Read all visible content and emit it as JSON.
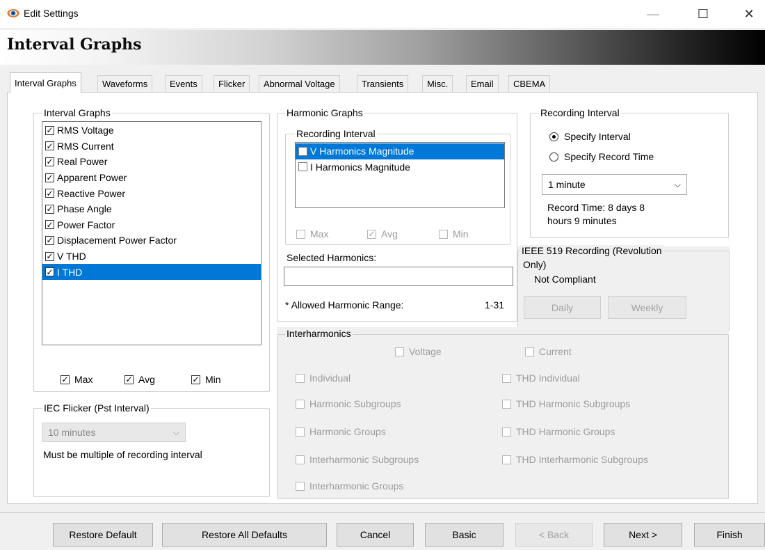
{
  "window": {
    "title": "Edit Settings",
    "minimize_glyph": "—",
    "maximize_glyph": "☐",
    "close_glyph": "✕"
  },
  "banner": {
    "title": "Interval Graphs"
  },
  "tabs": [
    {
      "label": "Interval Graphs",
      "active": true
    },
    {
      "label": "Waveforms"
    },
    {
      "label": "Events"
    },
    {
      "label": "Flicker"
    },
    {
      "label": "Abnormal Voltage"
    },
    {
      "label": "Transients"
    },
    {
      "label": "Misc."
    },
    {
      "label": "Email"
    },
    {
      "label": "CBEMA"
    }
  ],
  "interval_graphs": {
    "legend": "Interval Graphs",
    "items": [
      {
        "label": "RMS Voltage",
        "checked": true
      },
      {
        "label": "RMS Current",
        "checked": true
      },
      {
        "label": "Real Power",
        "checked": true
      },
      {
        "label": "Apparent Power",
        "checked": true
      },
      {
        "label": "Reactive Power",
        "checked": true
      },
      {
        "label": "Phase Angle",
        "checked": true
      },
      {
        "label": "Power Factor",
        "checked": true
      },
      {
        "label": "Displacement Power Factor",
        "checked": true
      },
      {
        "label": "V THD",
        "checked": true
      },
      {
        "label": "I THD",
        "checked": true,
        "selected": true
      }
    ],
    "max_label": "Max",
    "avg_label": "Avg",
    "min_label": "Min"
  },
  "iec_flicker": {
    "legend": "IEC Flicker (Pst Interval)",
    "selected": "10 minutes",
    "note": "Must be multiple of recording interval"
  },
  "harmonic_graphs": {
    "legend": "Harmonic Graphs",
    "recording_interval_legend": "Recording Interval",
    "items": [
      {
        "label": "V Harmonics Magnitude",
        "checked": false,
        "selected": true
      },
      {
        "label": "I Harmonics Magnitude",
        "checked": false
      }
    ],
    "max_label": "Max",
    "avg_label": "Avg",
    "min_label": "Min",
    "selected_harmonics_label": "Selected Harmonics:",
    "selected_harmonics_value": "",
    "allowed_range_label": "* Allowed Harmonic Range:",
    "allowed_range_value": "1-31"
  },
  "recording_interval": {
    "legend": "Recording Interval",
    "option_specify_interval": "Specify Interval",
    "option_specify_record_time": "Specify Record Time",
    "selected_option": "Specify Interval",
    "interval_value": "1 minute",
    "record_time_line1": "Record Time: 8 days 8",
    "record_time_line2": "hours 9 minutes"
  },
  "ieee519": {
    "legend_line1": "IEEE 519 Recording (Revolution",
    "legend_line2": "Only)",
    "status": "Not Compliant",
    "daily_label": "Daily",
    "weekly_label": "Weekly"
  },
  "interharmonics": {
    "legend": "Interharmonics",
    "voltage_label": "Voltage",
    "current_label": "Current",
    "left_options": [
      "Individual",
      "Harmonic Subgroups",
      "Harmonic Groups",
      "Interharmonic Subgroups",
      "Interharmonic Groups"
    ],
    "right_options": [
      "THD Individual",
      "THD Harmonic Subgroups",
      "THD Harmonic Groups",
      "THD Interharmonic Subgroups"
    ]
  },
  "footer": {
    "restore_default": "Restore Default",
    "restore_all_defaults": "Restore All Defaults",
    "cancel": "Cancel",
    "basic": "Basic",
    "back": "< Back",
    "next": "Next >",
    "finish": "Finish"
  },
  "icons": {
    "check": "✓",
    "dropdown": "⌵"
  },
  "colors": {
    "selection": "#0078d7",
    "disabled_text": "#9b9b9b",
    "dialog_bg": "#f0f0f0"
  }
}
